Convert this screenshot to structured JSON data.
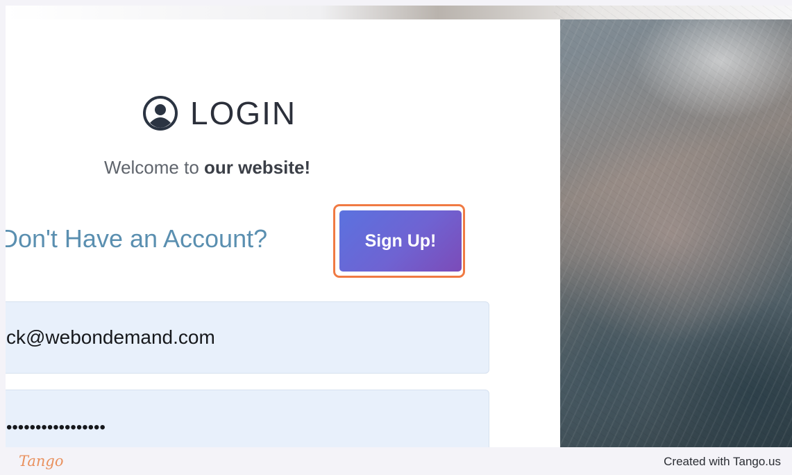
{
  "login": {
    "title": "LOGIN",
    "user_icon": "user-circle-icon",
    "welcome_prefix": "Welcome to ",
    "welcome_bold": "our website!",
    "no_account_text": "Don't Have an Account?",
    "signup_label": "Sign Up!",
    "email_value": "ck@webondemand.com",
    "password_value": "•••••••••••••••••"
  },
  "footer": {
    "logo_text": "Tango",
    "credit": "Created with Tango.us"
  },
  "colors": {
    "highlight": "#f07a43",
    "signup_start": "#5b72df",
    "signup_end": "#7c4bb8",
    "heading_blue": "#5a8fb0",
    "field_bg": "#e8f0fb"
  }
}
